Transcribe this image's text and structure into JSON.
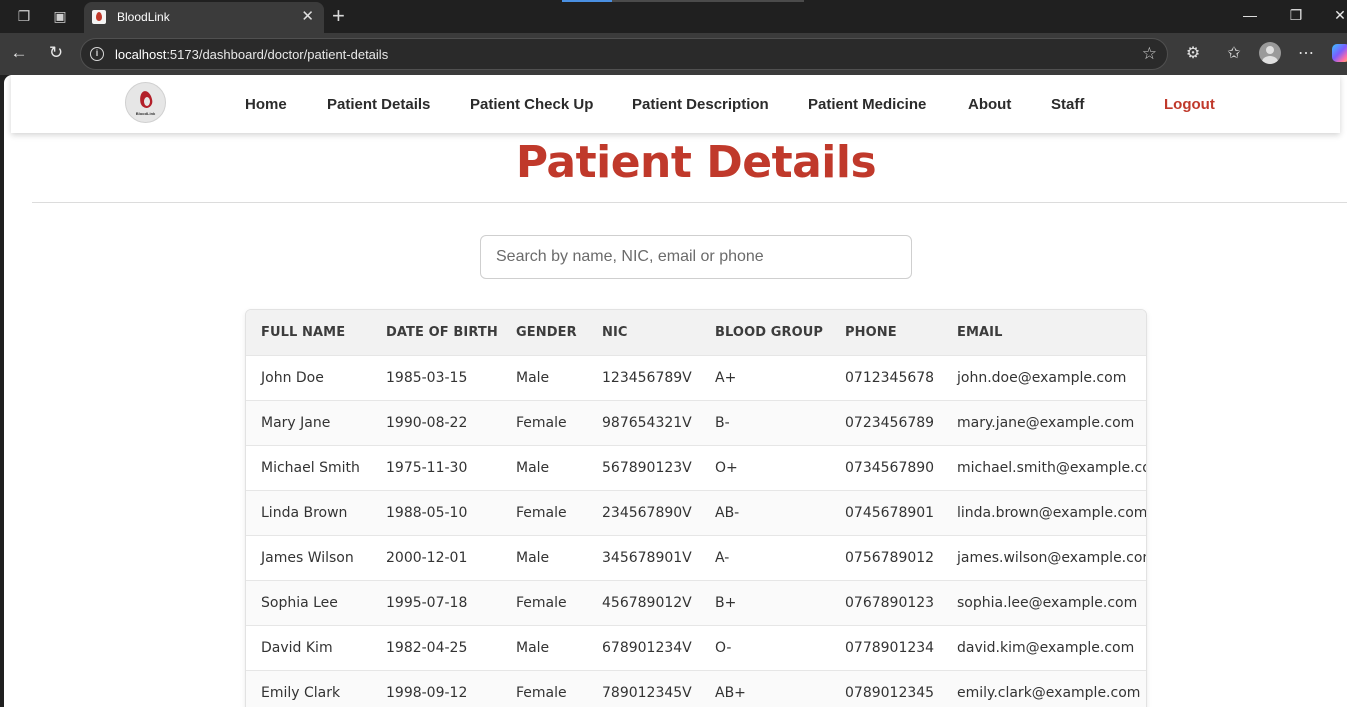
{
  "browser": {
    "tab_title": "BloodLink",
    "url_host": "localhost",
    "url_rest": ":5173/dashboard/doctor/patient-details"
  },
  "nav": {
    "logo_text": "BloodLink",
    "links": [
      "Home",
      "Patient Details",
      "Patient Check Up",
      "Patient Description",
      "Patient Medicine",
      "About",
      "Staff"
    ],
    "logout": "Logout"
  },
  "page": {
    "title": "Patient Details",
    "search_placeholder": "Search by name, NIC, email or phone"
  },
  "table": {
    "headers": [
      "FULL NAME",
      "DATE OF BIRTH",
      "GENDER",
      "NIC",
      "BLOOD GROUP",
      "PHONE",
      "EMAIL"
    ],
    "rows": [
      [
        "John Doe",
        "1985-03-15",
        "Male",
        "123456789V",
        "A+",
        "0712345678",
        "john.doe@example.com"
      ],
      [
        "Mary Jane",
        "1990-08-22",
        "Female",
        "987654321V",
        "B-",
        "0723456789",
        "mary.jane@example.com"
      ],
      [
        "Michael Smith",
        "1975-11-30",
        "Male",
        "567890123V",
        "O+",
        "0734567890",
        "michael.smith@example.com"
      ],
      [
        "Linda Brown",
        "1988-05-10",
        "Female",
        "234567890V",
        "AB-",
        "0745678901",
        "linda.brown@example.com"
      ],
      [
        "James Wilson",
        "2000-12-01",
        "Male",
        "345678901V",
        "A-",
        "0756789012",
        "james.wilson@example.com"
      ],
      [
        "Sophia Lee",
        "1995-07-18",
        "Female",
        "456789012V",
        "B+",
        "0767890123",
        "sophia.lee@example.com"
      ],
      [
        "David Kim",
        "1982-04-25",
        "Male",
        "678901234V",
        "O-",
        "0778901234",
        "david.kim@example.com"
      ],
      [
        "Emily Clark",
        "1998-09-12",
        "Female",
        "789012345V",
        "AB+",
        "0789012345",
        "emily.clark@example.com"
      ]
    ]
  },
  "colors": {
    "accent": "#c0392b",
    "header_bg": "#f2f2f2"
  }
}
